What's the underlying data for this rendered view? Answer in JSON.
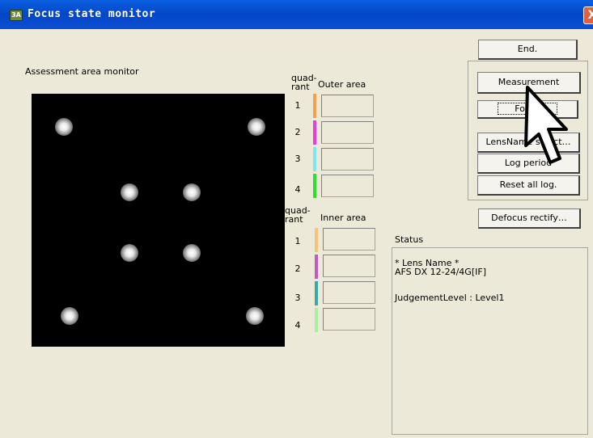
{
  "window": {
    "title": "Focus state monitor",
    "close_label": "X",
    "app_icon_label": "3A"
  },
  "monitor": {
    "label": "Assessment area monitor"
  },
  "outer": {
    "quadrant_label_1": "quad-",
    "quadrant_label_2": "rant",
    "area_label": "Outer area",
    "rows": [
      {
        "num": "1",
        "color": "#f2a24a"
      },
      {
        "num": "2",
        "color": "#e23ee0"
      },
      {
        "num": "3",
        "color": "#7fe6f0"
      },
      {
        "num": "4",
        "color": "#2fdf2f"
      }
    ]
  },
  "inner": {
    "quadrant_label_1": "quad-",
    "quadrant_label_2": "rant",
    "area_label": "Inner area",
    "rows": [
      {
        "num": "1",
        "color": "#f8c27a"
      },
      {
        "num": "2",
        "color": "#c05ac0"
      },
      {
        "num": "3",
        "color": "#3aa9a9"
      },
      {
        "num": "4",
        "color": "#a8f0a0"
      }
    ]
  },
  "buttons": {
    "end": "End.",
    "measurement": "Measurement",
    "focus": "Focus",
    "lens_name_select": "LensName select…",
    "log_period": "Log period",
    "reset_all_log": "Reset all log.",
    "defocus_rectify": "Defocus rectify…"
  },
  "status": {
    "label": "Status",
    "lens_name_header": "* Lens Name *",
    "lens_name_value": "AFS DX 12-24/4G[IF]",
    "judgement": "JudgementLevel : Level1"
  },
  "icons": {
    "cursor": "arrow-cursor-icon",
    "app": "app-icon"
  }
}
